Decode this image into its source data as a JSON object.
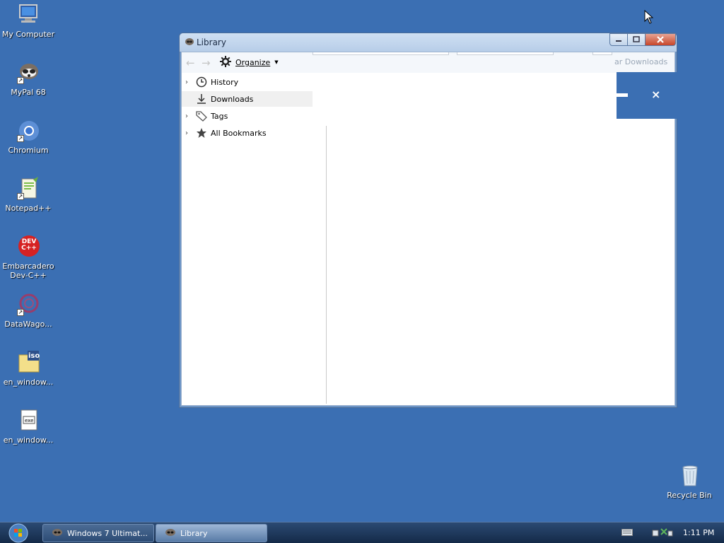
{
  "desktop": {
    "icons": [
      {
        "label": "My Computer",
        "icon": "computer-icon"
      },
      {
        "label": "MyPal 68",
        "icon": "mypal-icon"
      },
      {
        "label": "Chromium",
        "icon": "chromium-icon"
      },
      {
        "label": "Notepad++",
        "icon": "notepad-plus-plus-icon"
      },
      {
        "label": "Embarcadero Dev-C++",
        "icon": "devcpp-icon",
        "icon_text": "DEV C++"
      },
      {
        "label": "DataWago...",
        "icon": "datawagon-icon"
      },
      {
        "label": "en_window...",
        "icon": "iso-file-icon",
        "icon_text": "iso"
      },
      {
        "label": "en_window...",
        "icon": "exe-file-icon",
        "icon_text": "exe"
      },
      {
        "label": "Recycle Bin",
        "icon": "recycle-bin-icon"
      }
    ]
  },
  "window": {
    "title": "Library",
    "toolbar": {
      "organize_label": "Organize",
      "ghost_label": "ar Downloads"
    },
    "sidebar": [
      {
        "label": "History",
        "icon": "clock-icon",
        "expandable": true
      },
      {
        "label": "Downloads",
        "icon": "download-icon",
        "expandable": false,
        "selected": true
      },
      {
        "label": "Tags",
        "icon": "tag-icon",
        "expandable": true
      },
      {
        "label": "All Bookmarks",
        "icon": "star-icon",
        "expandable": true
      }
    ],
    "banner_close": "×"
  },
  "taskbar": {
    "buttons": [
      {
        "label": "Windows 7 Ultimat...",
        "active": false
      },
      {
        "label": "Library",
        "active": true
      }
    ],
    "clock": "1:11 PM"
  },
  "colors": {
    "desktop": "#3b6fb3",
    "taskbar": "#1c3556"
  }
}
